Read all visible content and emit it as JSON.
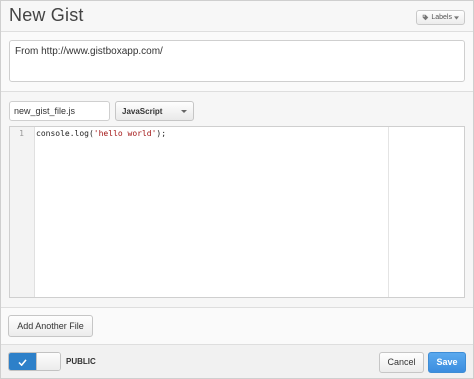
{
  "header": {
    "title": "New Gist",
    "labels_button": "Labels"
  },
  "description": {
    "value": "From http://www.gistboxapp.com/"
  },
  "file": {
    "filename": "new_gist_file.js",
    "language": "JavaScript",
    "lines": [
      {
        "number": "1",
        "code_prefix": "console.log(",
        "code_string": "'hello world'",
        "code_suffix": ");"
      }
    ]
  },
  "actions": {
    "add_file": "Add Another File"
  },
  "footer": {
    "visibility_label": "PUBLIC",
    "cancel": "Cancel",
    "save": "Save"
  },
  "colors": {
    "accent": "#2d80c9",
    "save_button": "#3b8ddf"
  }
}
